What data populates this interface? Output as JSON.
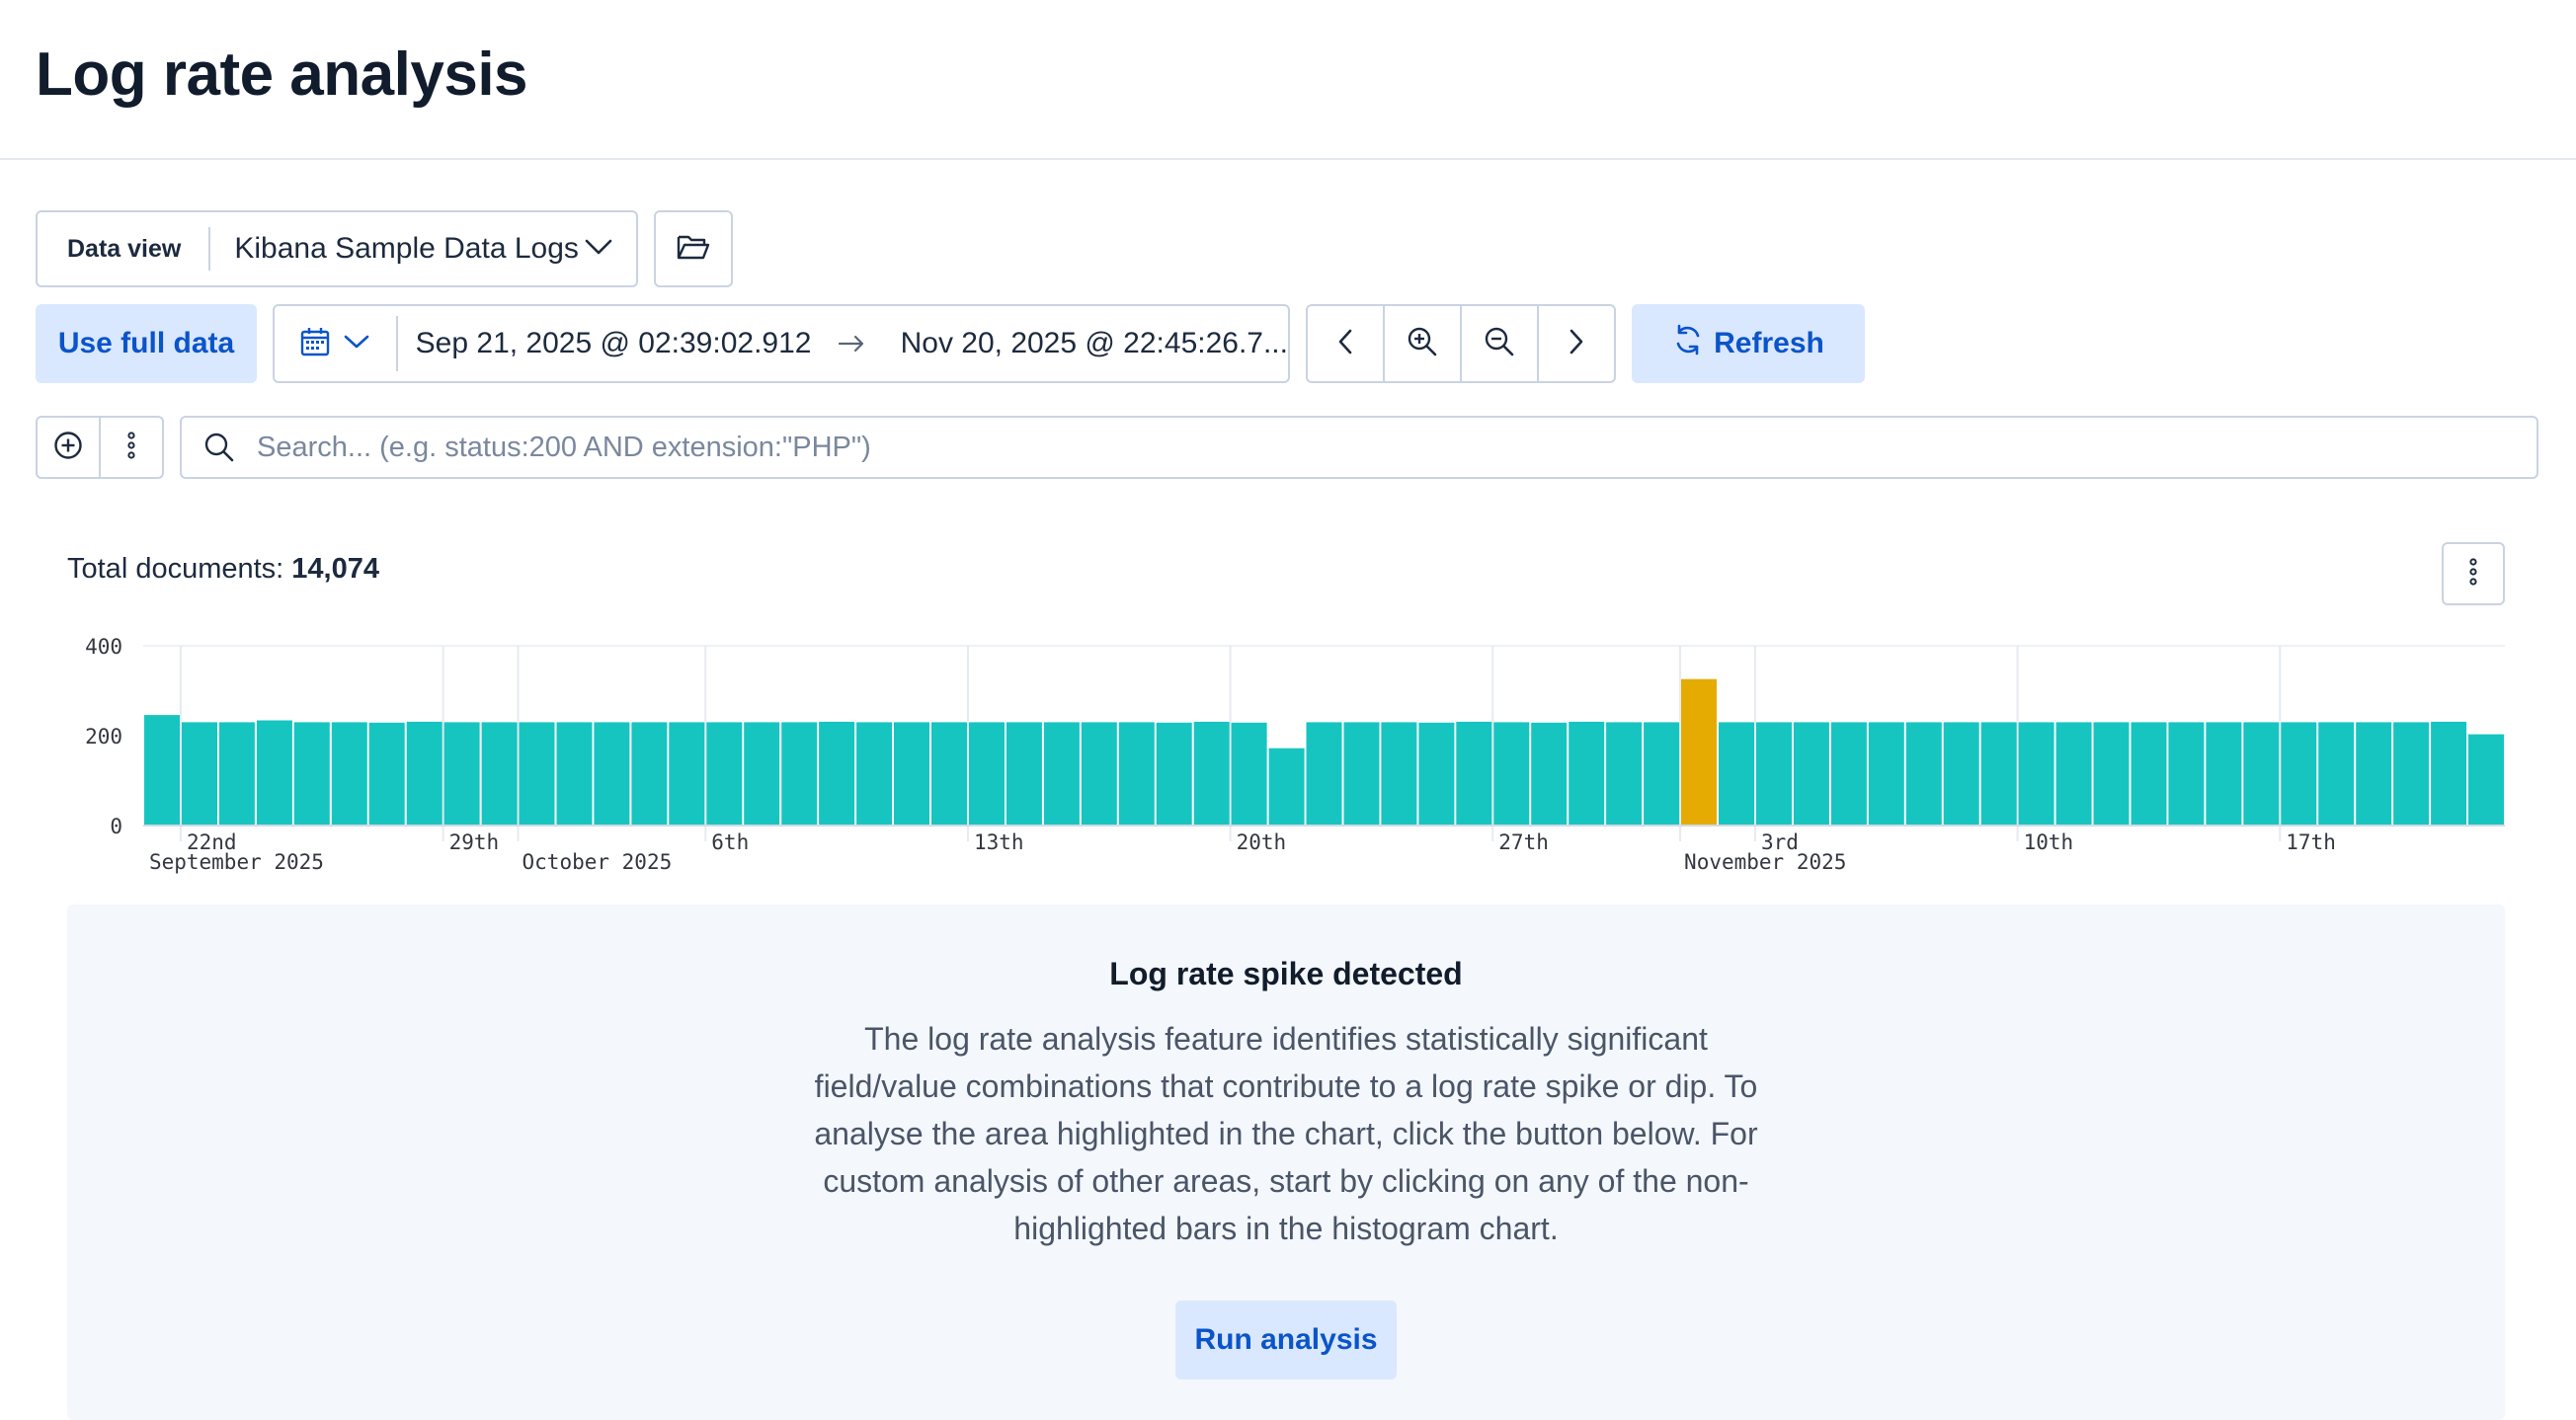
{
  "page": {
    "title": "Log rate analysis"
  },
  "data_view": {
    "label": "Data view",
    "value": "Kibana Sample Data Logs"
  },
  "toolbar": {
    "use_full_data_label": "Use full data",
    "start_date": "Sep 21, 2025 @ 02:39:02.912",
    "end_date": "Nov 20, 2025 @ 22:45:26.7...",
    "refresh_label": "Refresh"
  },
  "search": {
    "placeholder": "Search... (e.g. status:200 AND extension:\"PHP\")",
    "value": ""
  },
  "summary": {
    "label": "Total documents:",
    "count": "14,074"
  },
  "colors": {
    "bar": "#16c5c0",
    "highlight": "#e6ab02",
    "accent": "#0b54c9",
    "button_bg": "#d9e8ff"
  },
  "icons": [
    "chevron-down-icon",
    "folder-open-icon",
    "calendar-icon",
    "arrow-right-icon",
    "chevron-left-icon",
    "zoom-in-icon",
    "zoom-out-icon",
    "chevron-right-icon",
    "refresh-icon",
    "plus-circle-icon",
    "more-vertical-icon",
    "search-icon"
  ],
  "chart_data": {
    "type": "bar",
    "ylim": [
      0,
      400
    ],
    "yticks": [
      "0",
      "200",
      "400"
    ],
    "grid": true,
    "x_ticks": [
      {
        "label": "22nd",
        "sub": "September 2025",
        "index": 1
      },
      {
        "label": "29th",
        "index": 8
      },
      {
        "label": "",
        "sub": "October 2025",
        "index": 10
      },
      {
        "label": "6th",
        "index": 15
      },
      {
        "label": "13th",
        "index": 22
      },
      {
        "label": "20th",
        "index": 29
      },
      {
        "label": "27th",
        "index": 36
      },
      {
        "label": "",
        "sub": "November 2025",
        "index": 41
      },
      {
        "label": "3rd",
        "index": 43
      },
      {
        "label": "10th",
        "index": 50
      },
      {
        "label": "17th",
        "index": 57
      }
    ],
    "values": [
      246,
      230,
      230,
      234,
      230,
      230,
      229,
      231,
      230,
      230,
      230,
      230,
      230,
      230,
      230,
      230,
      230,
      230,
      231,
      230,
      230,
      230,
      230,
      230,
      230,
      230,
      230,
      229,
      231,
      229,
      172,
      230,
      230,
      230,
      229,
      231,
      230,
      229,
      231,
      230,
      230,
      326,
      230,
      230,
      230,
      230,
      230,
      230,
      230,
      230,
      230,
      230,
      230,
      230,
      230,
      230,
      230,
      230,
      230,
      230,
      230,
      231,
      203
    ],
    "highlight_index": 41
  },
  "callout": {
    "title": "Log rate spike detected",
    "body": "The log rate analysis feature identifies statistically significant field/value combinations that contribute to a log rate spike or dip. To analyse the area highlighted in the chart, click the button below. For custom analysis of other areas, start by clicking on any of the non-highlighted bars in the histogram chart.",
    "button_label": "Run analysis"
  }
}
